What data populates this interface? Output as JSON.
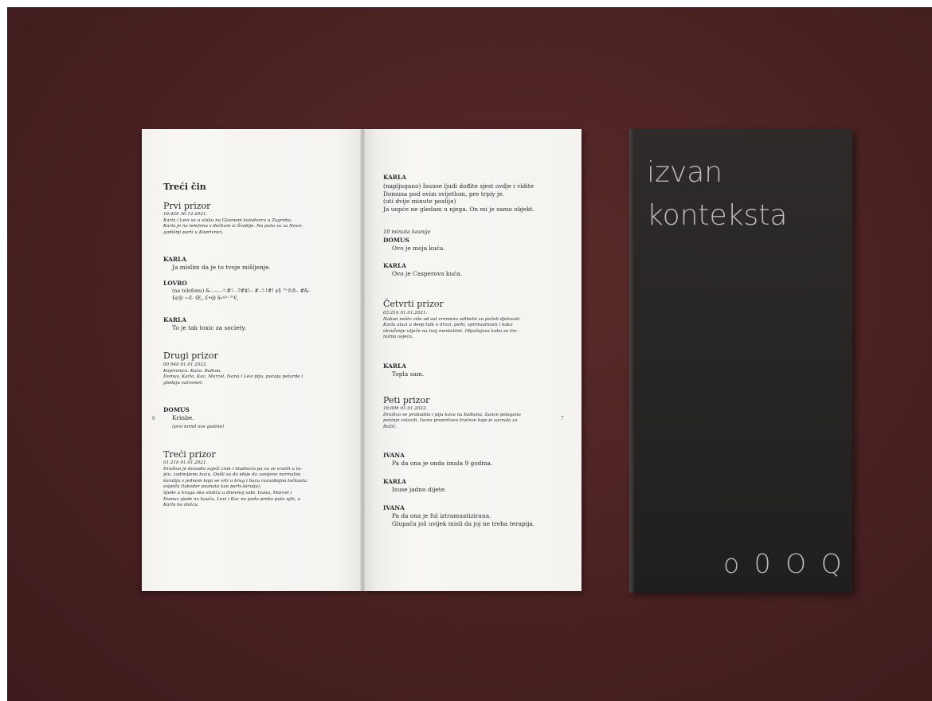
{
  "left_page": {
    "act_title": "Treći čin",
    "scene1": {
      "title": "Prvi prizor",
      "meta": "18:42h 30.12.2021.\nKarla i Levi su u vlaku na Glavnom kolodvoru u Zagrebu.\nKarla je na telefonu s dečkom iz Švabije. Na putu su za Novo-\ngodišnji parti u Koprivnici.",
      "speakers": [
        {
          "name": "KARLA",
          "line": "Ja mislim da je to tvoje mišljenje."
        },
        {
          "name": "LOVRO",
          "line": "(na telefonu) &-.---..-²-#!- -?#$!-- #--!-!#! ¢§ ™©ð-. #&-\n£¢@ ~€- Œ„ £•@ §«º¹·™€,"
        },
        {
          "name": "KARLA",
          "line": "To je tak toxic za society."
        }
      ]
    },
    "scene2": {
      "title": "Drugi prizor",
      "meta": "00:54h 01.01.2022.\nKoprivnica. Kuća. Balkon.\nDomus, Karla, Kac, Marcel, Ivana i Levi piju, pucaju petarde i\ngledaju vatromet.",
      "speaker": "DOMUS",
      "line": "Krinbe.",
      "direction": "(prvi krinđ ove godine)"
    },
    "scene3": {
      "title": "Treći prizor",
      "meta": "01:21h 01.01.2021.\nDruštvo je dovadio svježi zrak i hladnoća pa su se vratili u to-\nplu, zadimljenu kuću. Došli su do ideje da zanijene normalnu\nšaruliju s jednom koja se vrti u krug i baca razuobojna točkasta\nsvijetla (također poznata kao parti-šarulja).\nSjede u krugu oko stolića u dnevnoj sobi. Ivana, Marcel i\nDomus sjede na kauču, Levi i Kac na podu preko puta njih, a\nKarla na stolcu."
    },
    "page_number": "6"
  },
  "right_page": {
    "block1": {
      "speaker": "KARLA",
      "text": "(napljugano) Isuuse ljudi dođite sjest ovdje i vidite\nDomusa pod ovim svijetlom, pre trpiy je.\n(uti dvije minute poslije)\nJa uopće ne gledam u njega. On mi je samo objekt."
    },
    "direction": "10 minuta kasnije",
    "block2": {
      "speaker": "DOMUS",
      "line": "Ovo je moja kuća."
    },
    "block3": {
      "speaker": "KARLA",
      "line": "Ovo je Casperova kuća."
    },
    "scene4": {
      "title": "Četvrti prizor",
      "meta": "03:21h 01.01.2021.\nNakon nešto više od sat vremena edibelsi su počeli djelovati.\nKarla ulazi u deep talk o drozi, psihi, spiritualnosti i kako\nokruženje utječe na tvoj mentalitet. Objašnjava kako se tre-\nnutno osjeća.",
      "speaker": "KARLA",
      "line": "Topla sam."
    },
    "scene5": {
      "title": "Peti prizor",
      "meta": "16:00h 01.01.2022.\nDruštvo se probudilo i piju kavu na balkonu. Sunce polagano\npočinje zalaziti. Ivana prepričava tračeve koje je saznala za\nBožić.",
      "speakers": [
        {
          "name": "IVANA",
          "line": "Pa da ona je onda imala 9 godina."
        },
        {
          "name": "KARLA",
          "line": "Isuse jadno dijete."
        },
        {
          "name": "IVANA",
          "line": "Pa da ona je ful iztramuatizirana.\nGlupača još uvijek misli da joj ne treba terapija."
        }
      ]
    },
    "page_number": "7"
  },
  "cover": {
    "title_line1": "izvan",
    "title_line2": "konteksta",
    "mark": "o 0 O Q"
  }
}
